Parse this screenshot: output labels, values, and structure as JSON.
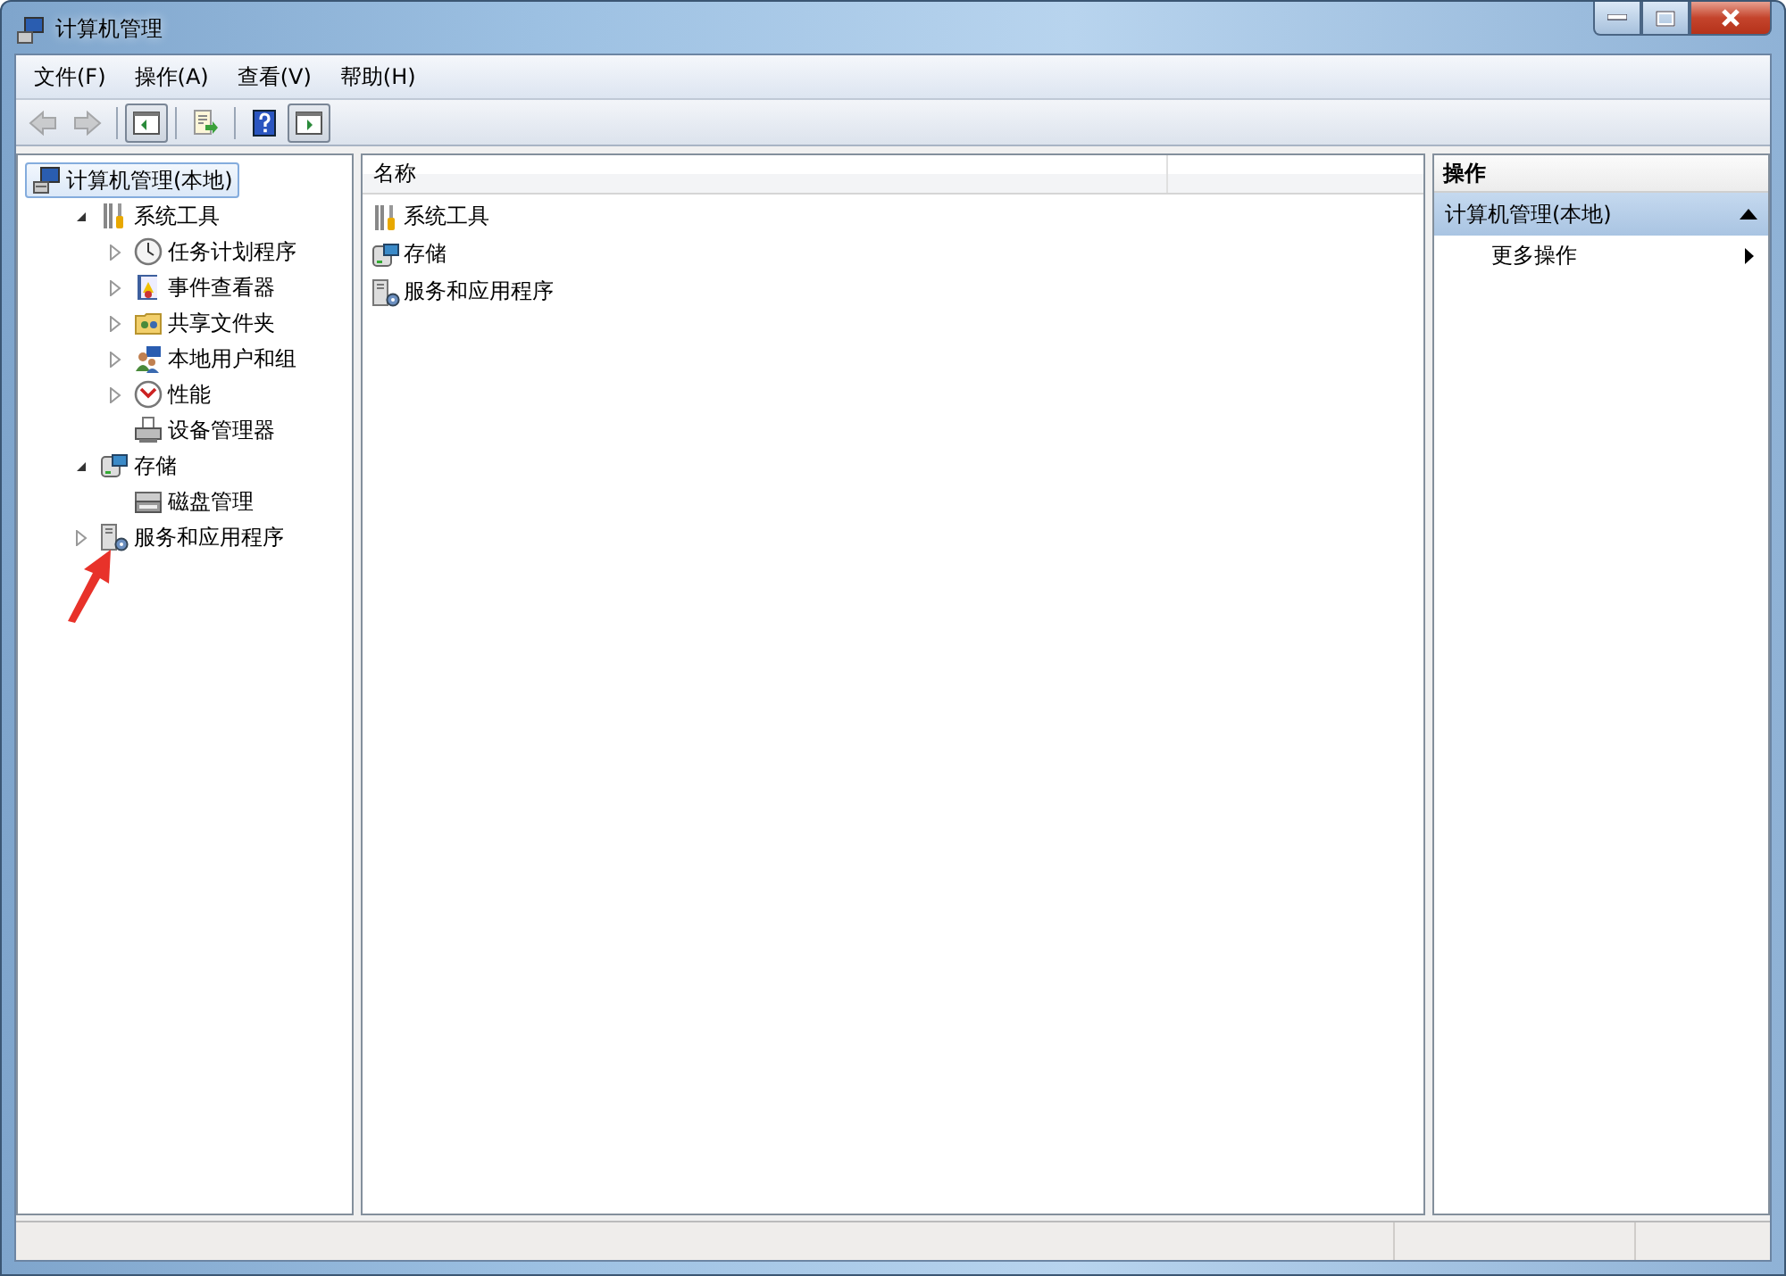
{
  "window": {
    "title": "计算机管理"
  },
  "menu": [
    {
      "label": "文件(F)"
    },
    {
      "label": "操作(A)"
    },
    {
      "label": "查看(V)"
    },
    {
      "label": "帮助(H)"
    }
  ],
  "toolbar": [
    {
      "kind": "back",
      "disabled": true,
      "pressed": false
    },
    {
      "kind": "forward",
      "disabled": true,
      "pressed": false
    },
    {
      "kind": "separator"
    },
    {
      "kind": "tree-toggle",
      "disabled": false,
      "pressed": true
    },
    {
      "kind": "separator"
    },
    {
      "kind": "export",
      "disabled": false,
      "pressed": false
    },
    {
      "kind": "separator"
    },
    {
      "kind": "help",
      "disabled": false,
      "pressed": false
    },
    {
      "kind": "action-toggle",
      "disabled": false,
      "pressed": true
    }
  ],
  "tree": {
    "label": "计算机管理(本地)",
    "kind": "computer",
    "selected": true,
    "children": [
      {
        "label": "系统工具",
        "kind": "tools",
        "selected": false,
        "expandable": true,
        "expanded": true,
        "children": [
          {
            "label": "任务计划程序",
            "kind": "clock",
            "selected": false,
            "expandable": true,
            "expanded": false
          },
          {
            "label": "事件查看器",
            "kind": "log",
            "selected": false,
            "expandable": true,
            "expanded": false
          },
          {
            "label": "共享文件夹",
            "kind": "share",
            "selected": false,
            "expandable": true,
            "expanded": false
          },
          {
            "label": "本地用户和组",
            "kind": "users",
            "selected": false,
            "expandable": true,
            "expanded": false
          },
          {
            "label": "性能",
            "kind": "gauge",
            "selected": false,
            "expandable": true,
            "expanded": false
          },
          {
            "label": "设备管理器",
            "kind": "device",
            "selected": false,
            "expandable": false,
            "expanded": false
          }
        ]
      },
      {
        "label": "存储",
        "kind": "storage",
        "selected": false,
        "expandable": true,
        "expanded": true,
        "children": [
          {
            "label": "磁盘管理",
            "kind": "disk",
            "selected": false,
            "expandable": false,
            "expanded": false
          }
        ]
      },
      {
        "label": "服务和应用程序",
        "kind": "services",
        "selected": false,
        "expandable": true,
        "expanded": false
      }
    ]
  },
  "list": {
    "columns": [
      "名称"
    ],
    "rows": [
      {
        "label": "系统工具",
        "kind": "tools"
      },
      {
        "label": "存储",
        "kind": "storage"
      },
      {
        "label": "服务和应用程序",
        "kind": "services"
      }
    ]
  },
  "actions": {
    "header": "操作",
    "section": {
      "title": "计算机管理(本地)",
      "expanded": true
    },
    "items": [
      {
        "label": "更多操作"
      }
    ]
  }
}
